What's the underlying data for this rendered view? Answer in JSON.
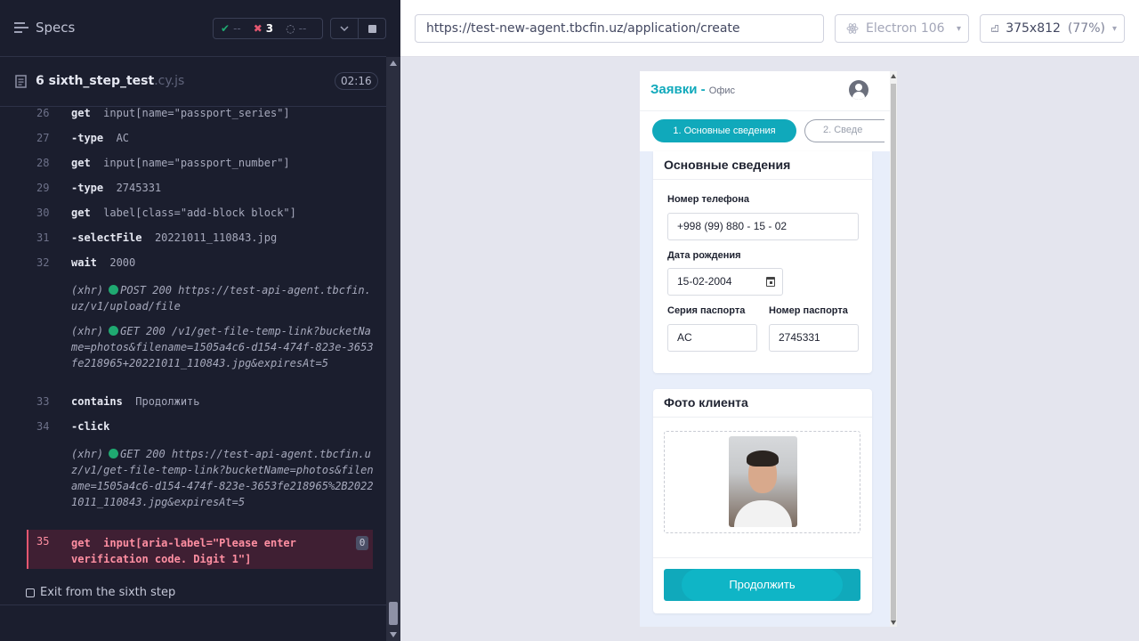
{
  "reporter": {
    "specs_label": "Specs",
    "stats": {
      "passed": "--",
      "failed": "3",
      "pending": "--"
    },
    "spec": {
      "name": "6 sixth_step_test",
      "ext": ".cy.js",
      "duration": "02:16"
    },
    "commands": [
      {
        "num": "26",
        "name": "get",
        "arg": "input[name=\"passport_series\"]"
      },
      {
        "num": "27",
        "name": "-type",
        "arg": "AC"
      },
      {
        "num": "28",
        "name": "get",
        "arg": "input[name=\"passport_number\"]"
      },
      {
        "num": "29",
        "name": "-type",
        "arg": "2745331"
      },
      {
        "num": "30",
        "name": "get",
        "arg": "label[class=\"add-block block\"]"
      },
      {
        "num": "31",
        "name": "-selectFile",
        "arg": "20221011_110843.jpg"
      },
      {
        "num": "32",
        "name": "wait",
        "arg": "2000"
      },
      {
        "num": "33",
        "name": "contains",
        "arg": "Продолжить"
      },
      {
        "num": "34",
        "name": "-click",
        "arg": ""
      }
    ],
    "xhr": [
      {
        "prefix": "(xhr)",
        "text": "POST 200 https://test-api-agent.tbcfin.uz/v1/upload/file"
      },
      {
        "prefix": "(xhr)",
        "text": "GET 200 /v1/get-file-temp-link?bucketName=photos&filename=1505a4c6-d154-474f-823e-3653fe218965+20221011_110843.jpg&expiresAt=5"
      },
      {
        "prefix": "(xhr)",
        "text": "GET 200 https://test-api-agent.tbcfin.uz/v1/get-file-temp-link?bucketName=photos&filename=1505a4c6-d154-474f-823e-3653fe218965%2B20221011_110843.jpg&expiresAt=5"
      }
    ],
    "failed": {
      "num": "35",
      "name": "get",
      "arg": "input[aria-label=\"Please enter verification code. Digit 1\"]",
      "badge": "0"
    },
    "suite_label": "Exit from the sixth step"
  },
  "aut": {
    "url": "https://test-new-agent.tbcfin.uz/application/create",
    "browser": "Electron 106",
    "viewport": "375x812",
    "scale": "(77%)"
  },
  "app": {
    "title": "Заявки -",
    "subtitle": "Офис",
    "steps": [
      "1. Основные сведения",
      "2. Сведе"
    ],
    "basic": {
      "title": "Основные сведения",
      "phone_label": "Номер телефона",
      "phone_value": "+998 (99) 880 - 15 - 02",
      "dob_label": "Дата рождения",
      "dob_value": "15-02-2004",
      "series_label": "Серия паспорта",
      "series_value": "AC",
      "number_label": "Номер паспорта",
      "number_value": "2745331"
    },
    "photo": {
      "title": "Фото клиента"
    },
    "continue_label": "Продолжить"
  },
  "colors": {
    "accent": "#10a9bb",
    "pass": "#1fa971",
    "fail": "#e45770"
  }
}
